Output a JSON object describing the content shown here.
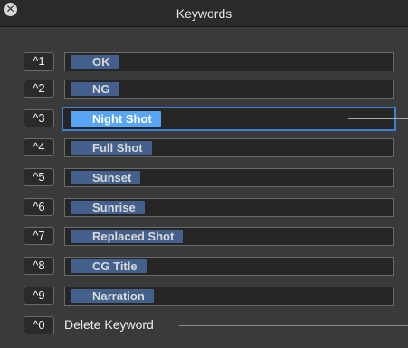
{
  "window": {
    "title": "Keywords",
    "close_glyph": "✕"
  },
  "keywords": [
    {
      "shortcut": "^1",
      "label": "OK"
    },
    {
      "shortcut": "^2",
      "label": "NG"
    },
    {
      "shortcut": "^3",
      "label": "Night Shot",
      "selected": true
    },
    {
      "shortcut": "^4",
      "label": "Full Shot"
    },
    {
      "shortcut": "^5",
      "label": "Sunset"
    },
    {
      "shortcut": "^6",
      "label": "Sunrise"
    },
    {
      "shortcut": "^7",
      "label": "Replaced Shot"
    },
    {
      "shortcut": "^8",
      "label": "CG Title"
    },
    {
      "shortcut": "^9",
      "label": "Narration"
    }
  ],
  "delete": {
    "shortcut": "^0",
    "label": "Delete Keyword"
  },
  "colors": {
    "chip": "#44608c",
    "chip_selected": "#58a4f5",
    "focus_ring": "#3e7fd4"
  }
}
